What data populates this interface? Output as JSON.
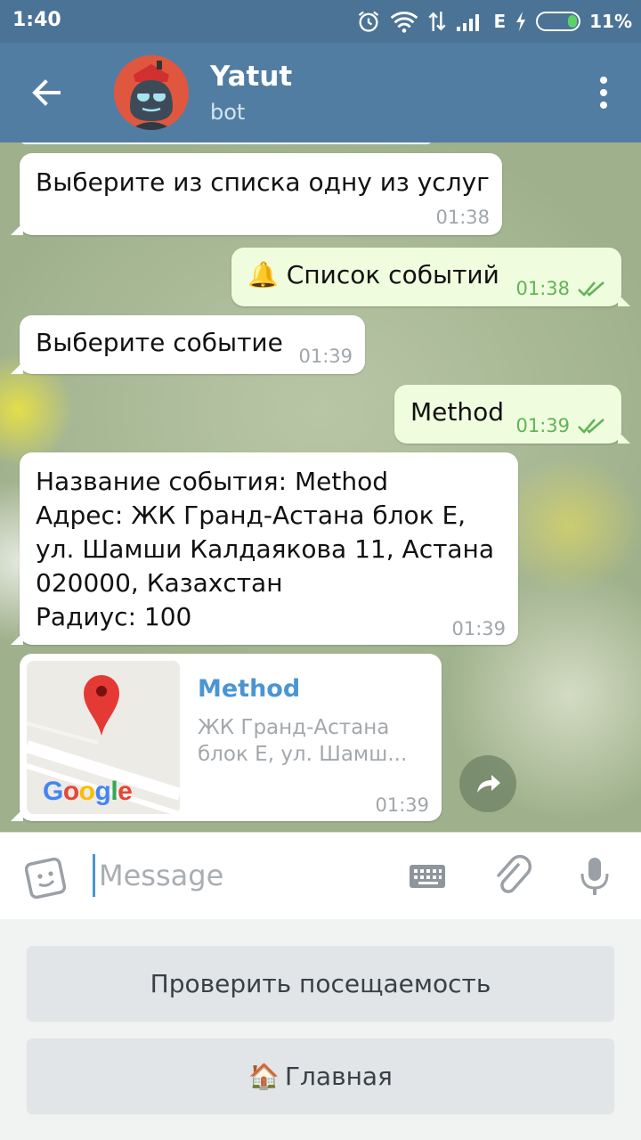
{
  "status_bar": {
    "time": "1:40",
    "network": "E",
    "battery": "11%"
  },
  "header": {
    "title": "Yatut",
    "subtitle": "bot"
  },
  "messages": [
    {
      "direction": "in",
      "text": "Выберите из списка одну из услуг",
      "time": "01:38"
    },
    {
      "direction": "out",
      "emoji": "🔔",
      "text": "Список событий",
      "time": "01:38"
    },
    {
      "direction": "in",
      "text": "Выберите событие",
      "time": "01:39"
    },
    {
      "direction": "out",
      "text": "Method",
      "time": "01:39"
    },
    {
      "direction": "in",
      "lines": [
        "Название события: Method",
        "Адрес: ЖК Гранд-Астана блок Е,",
        "ул. Шамши Калдаякова 11, Астана",
        "020000, Казахстан",
        "Радиус: 100"
      ],
      "time": "01:39"
    },
    {
      "direction": "in",
      "type": "venue",
      "title": "Method",
      "address_line1": "ЖК Гранд-Астана",
      "address_line2": "блок Е, ул. Шамш...",
      "map_brand": "Google",
      "time": "01:39"
    }
  ],
  "input": {
    "placeholder": "Message"
  },
  "keyboard": {
    "buttons": [
      {
        "label": "Проверить посещаемость"
      },
      {
        "emoji": "🏠",
        "label": "Главная"
      }
    ]
  },
  "colors": {
    "header": "#527da3",
    "status_bar": "#4b7396",
    "outgoing_bubble": "#effdde",
    "incoming_bubble": "#ffffff",
    "link": "#4a95d2",
    "check": "#5fb456"
  }
}
